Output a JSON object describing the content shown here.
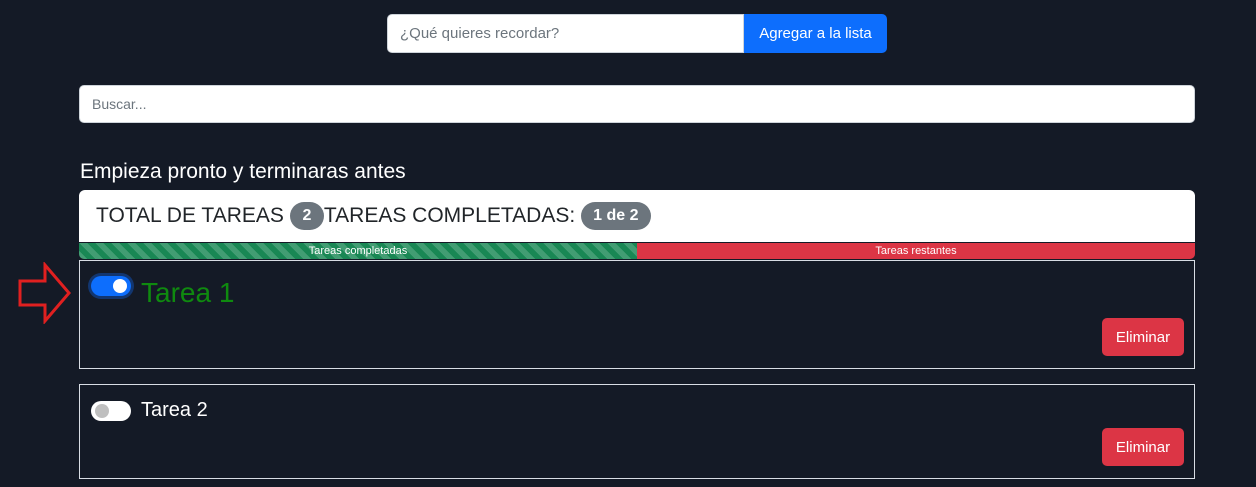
{
  "add_form": {
    "placeholder": "¿Qué quieres recordar?",
    "button_label": "Agregar a la lista",
    "button_color": "#0d6efd"
  },
  "search": {
    "placeholder": "Buscar..."
  },
  "heading": "Empieza pronto y terminaras antes",
  "stats": {
    "total_label": "TOTAL DE TAREAS",
    "total_count": "2",
    "completed_label": "TAREAS COMPLETADAS:",
    "completed_badge": "1 de 2"
  },
  "progress": {
    "completed_fraction": 0.5,
    "completed_label": "Tareas completadas",
    "remaining_label": "Tareas restantes",
    "completed_color": "#198754",
    "remaining_color": "#dc3545"
  },
  "tasks": [
    {
      "name": "Tarea 1",
      "done": true,
      "delete_label": "Eliminar"
    },
    {
      "name": "Tarea 2",
      "done": false,
      "delete_label": "Eliminar"
    }
  ],
  "annotation": {
    "icon": "arrow-right-icon",
    "color": "#e02020"
  }
}
